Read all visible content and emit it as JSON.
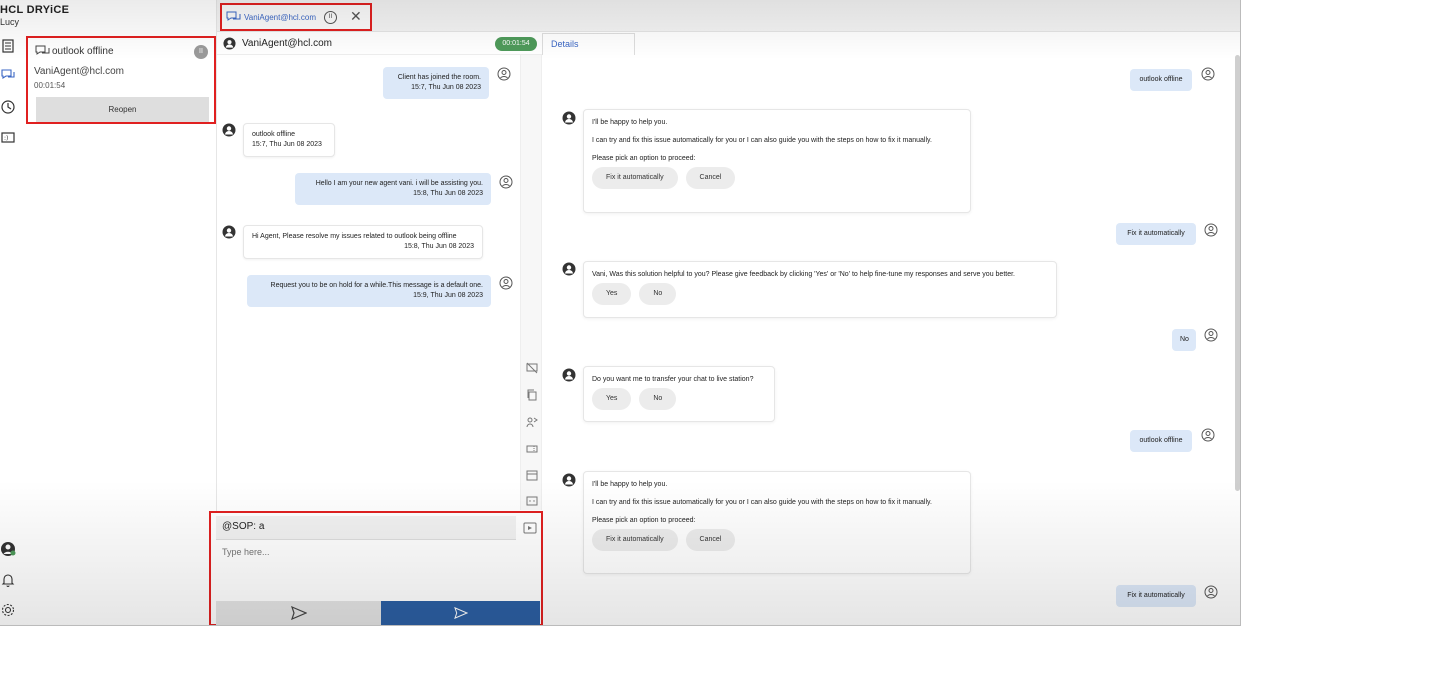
{
  "brand": {
    "name": "HCL DRYiCE",
    "user": "Lucy"
  },
  "rail": {
    "icons": [
      "list-icon",
      "chat-icon",
      "history-icon",
      "ticket-icon",
      "user-status-icon",
      "bell-icon",
      "gear-icon"
    ]
  },
  "session": {
    "title": "outlook offline",
    "agent": "VaniAgent@hcl.com",
    "time": "00:01:54",
    "reopen_label": "Reopen"
  },
  "tab": {
    "label": "VaniAgent@hcl.com"
  },
  "chat_header": {
    "name": "VaniAgent@hcl.com",
    "timer": "00:01:54"
  },
  "details_tab": "Details",
  "conversation": [
    {
      "who": "agent",
      "text": "Client has joined the room.",
      "ts": "15:7, Thu Jun 08 2023"
    },
    {
      "who": "user",
      "text": "outlook offline",
      "ts": "15:7, Thu Jun 08 2023"
    },
    {
      "who": "agent",
      "text": "Hello I am your new agent vani. i will be assisting you.",
      "ts": "15:8, Thu Jun 08 2023"
    },
    {
      "who": "user",
      "text": "Hi Agent, Please resolve my issues related to outlook being offline",
      "ts": "15:8, Thu Jun 08 2023"
    },
    {
      "who": "agent",
      "text": "Request you to be on hold for a while.This message is a default one.",
      "ts": "15:9, Thu Jun 08 2023"
    }
  ],
  "composer": {
    "sop_value": "@SOP: a",
    "placeholder": "Type here..."
  },
  "details": {
    "u1": "outlook offline",
    "card1": {
      "l1": "I'll be happy to help you.",
      "l2": "I can try and fix this issue automatically for you or I can also guide you with the steps on how to fix it manually.",
      "l3": "Please pick an option to proceed:",
      "opt1": "Fix it automatically",
      "opt2": "Cancel"
    },
    "u2": "Fix it automatically",
    "card2": {
      "l1": "Vani, Was this solution helpful to you? Please give feedback by clicking 'Yes' or 'No' to help fine-tune my responses and serve you better.",
      "opt1": "Yes",
      "opt2": "No"
    },
    "u3": "No",
    "card3": {
      "l1": "Do you want me to transfer your chat to live station?",
      "opt1": "Yes",
      "opt2": "No"
    },
    "u4": "outlook offline",
    "card4": {
      "l1": "I'll be happy to help you.",
      "l2": "I can try and fix this issue automatically for you or I can also guide you with the steps on how to fix it manually.",
      "l3": "Please pick an option to proceed:",
      "opt1": "Fix it automatically",
      "opt2": "Cancel"
    },
    "u5": "Fix it automatically"
  },
  "colors": {
    "highlight": "#e02020",
    "agent_bubble": "#dce8f8",
    "send_button": "#2c5fa3",
    "timer_badge": "#4e9a5a",
    "link": "#3a66c4"
  }
}
